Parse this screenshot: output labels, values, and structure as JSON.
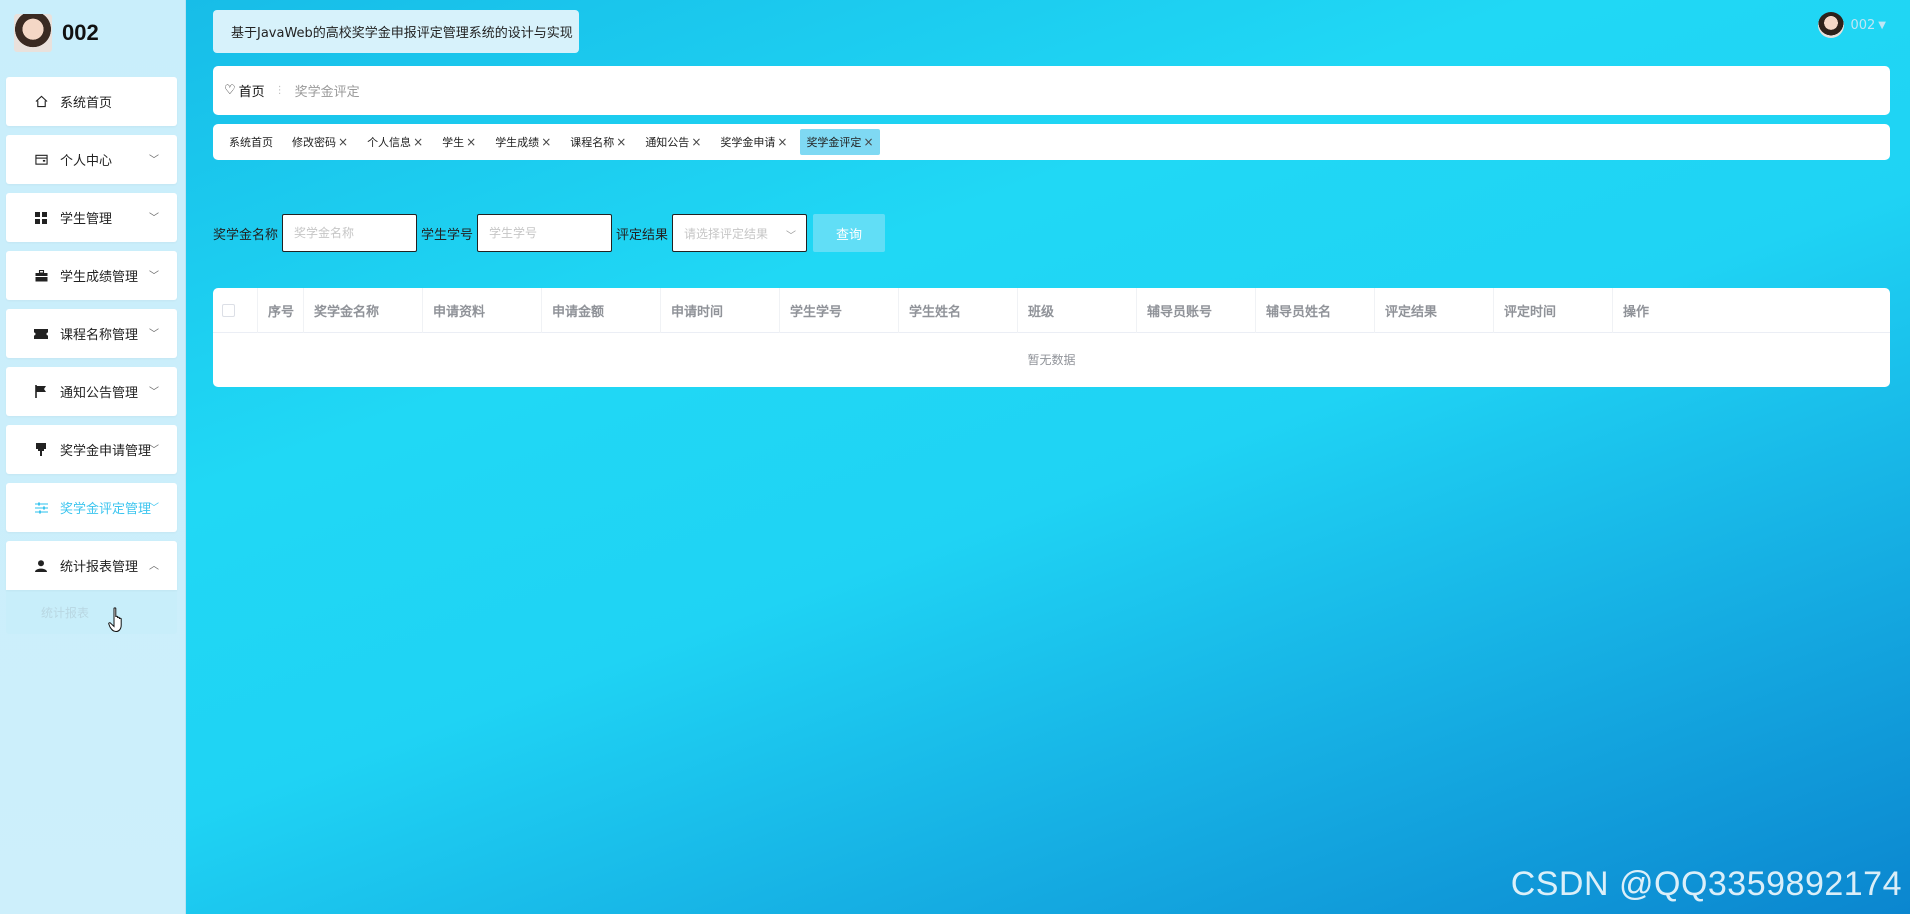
{
  "sidebar": {
    "brand_name": "002",
    "menu": [
      {
        "label": "系统首页",
        "icon": "home-icon",
        "arrow": ""
      },
      {
        "label": "个人中心",
        "icon": "wallet-icon",
        "arrow": "﹀"
      },
      {
        "label": "学生管理",
        "icon": "grid-icon",
        "arrow": "﹀"
      },
      {
        "label": "学生成绩管理",
        "icon": "briefcase-icon",
        "arrow": "﹀"
      },
      {
        "label": "课程名称管理",
        "icon": "ticket-icon",
        "arrow": "﹀"
      },
      {
        "label": "通知公告管理",
        "icon": "flag-icon",
        "arrow": "﹀"
      },
      {
        "label": "奖学金申请管理",
        "icon": "stamp-icon",
        "arrow": "﹀"
      },
      {
        "label": "奖学金评定管理",
        "icon": "sliders-icon",
        "arrow": "﹀"
      },
      {
        "label": "统计报表管理",
        "icon": "user-icon",
        "arrow": "︿"
      }
    ],
    "submenu_label": "统计报表"
  },
  "header": {
    "app_title": "基于JavaWeb的高校奖学金申报评定管理系统的设计与实现",
    "user_name": "002"
  },
  "breadcrumb": {
    "home": "首页",
    "separator": "⋮",
    "current": "奖学金评定"
  },
  "tags": [
    {
      "label": "系统首页",
      "closable": false
    },
    {
      "label": "修改密码",
      "closable": true
    },
    {
      "label": "个人信息",
      "closable": true
    },
    {
      "label": "学生",
      "closable": true
    },
    {
      "label": "学生成绩",
      "closable": true
    },
    {
      "label": "课程名称",
      "closable": true
    },
    {
      "label": "通知公告",
      "closable": true
    },
    {
      "label": "奖学金申请",
      "closable": true
    },
    {
      "label": "奖学金评定",
      "closable": true
    }
  ],
  "search": {
    "name_label": "奖学金名称",
    "name_placeholder": "奖学金名称",
    "student_no_label": "学生学号",
    "student_no_placeholder": "学生学号",
    "result_label": "评定结果",
    "result_placeholder": "请选择评定结果",
    "query_button": "查询"
  },
  "table": {
    "columns": [
      "序号",
      "奖学金名称",
      "申请资料",
      "申请金额",
      "申请时间",
      "学生学号",
      "学生姓名",
      "班级",
      "辅导员账号",
      "辅导员姓名",
      "评定结果",
      "评定时间",
      "操作"
    ],
    "empty_text": "暂无数据"
  },
  "watermark": "CSDN @QQ3359892174",
  "colors": {
    "accent": "#3dc5ef",
    "active_tag": "#7fd9f3",
    "query_button": "#61def6"
  }
}
